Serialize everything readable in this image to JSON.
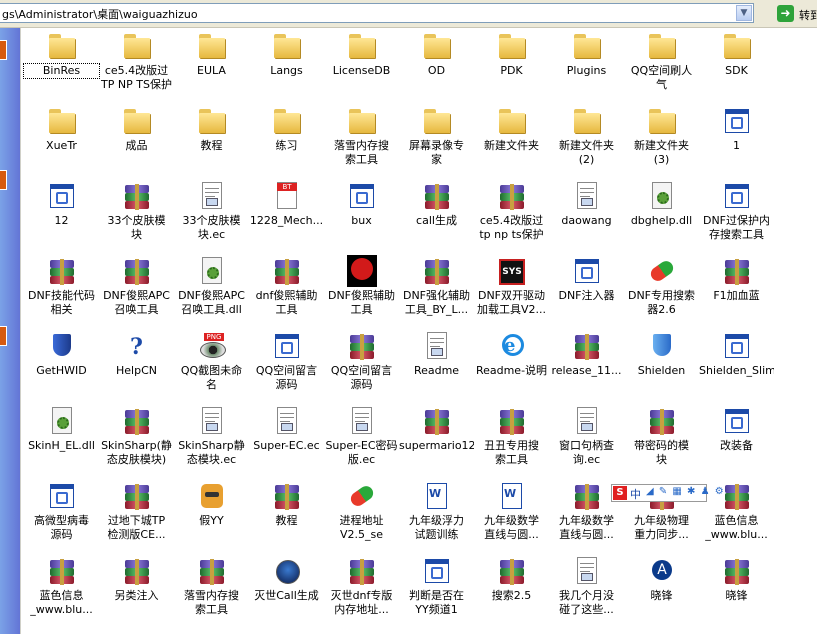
{
  "address_bar": {
    "path": "gs\\Administrator\\桌面\\waiguazhizuo",
    "go_label": "转到"
  },
  "items": [
    {
      "label": "BinRes",
      "kind": "folder"
    },
    {
      "label": "ce5.4改版过\nTP NP TS保护",
      "kind": "folder"
    },
    {
      "label": "EULA",
      "kind": "folder"
    },
    {
      "label": "Langs",
      "kind": "folder"
    },
    {
      "label": "LicenseDB",
      "kind": "folder"
    },
    {
      "label": "OD",
      "kind": "folder"
    },
    {
      "label": "PDK",
      "kind": "folder"
    },
    {
      "label": "Plugins",
      "kind": "folder"
    },
    {
      "label": "QQ空间刷人\n气",
      "kind": "folder"
    },
    {
      "label": "SDK",
      "kind": "folder"
    },
    {
      "label": "XueTr",
      "kind": "folder"
    },
    {
      "label": "成品",
      "kind": "folder"
    },
    {
      "label": "教程",
      "kind": "folder"
    },
    {
      "label": "练习",
      "kind": "folder"
    },
    {
      "label": "落雪内存搜\n索工具",
      "kind": "folder"
    },
    {
      "label": "屏幕录像专\n家",
      "kind": "folder"
    },
    {
      "label": "新建文件夹",
      "kind": "folder"
    },
    {
      "label": "新建文件夹\n(2)",
      "kind": "folder"
    },
    {
      "label": "新建文件夹\n(3)",
      "kind": "folder"
    },
    {
      "label": "1",
      "kind": "exe"
    },
    {
      "label": "12",
      "kind": "exe"
    },
    {
      "label": "33个皮肤模\n块",
      "kind": "rar"
    },
    {
      "label": "33个皮肤模\n块.ec",
      "kind": "doc"
    },
    {
      "label": "1228_Mech...",
      "kind": "bt"
    },
    {
      "label": "bux",
      "kind": "exe"
    },
    {
      "label": "call生成",
      "kind": "rar"
    },
    {
      "label": "ce5.4改版过\ntp np ts保护",
      "kind": "rar"
    },
    {
      "label": "daowang",
      "kind": "doc"
    },
    {
      "label": "dbghelp.dll",
      "kind": "dll"
    },
    {
      "label": "DNF过保护内\n存搜索工具",
      "kind": "exe"
    },
    {
      "label": "DNF技能代码\n相关",
      "kind": "rar"
    },
    {
      "label": "DNF俊熙APC\n召唤工具",
      "kind": "rar"
    },
    {
      "label": "DNF俊熙APC\n召唤工具.dll",
      "kind": "dll"
    },
    {
      "label": "dnf俊熙辅助\n工具",
      "kind": "rar"
    },
    {
      "label": "DNF俊熙辅助\n工具",
      "kind": "rose"
    },
    {
      "label": "DNF强化辅助\n工具_BY_L...",
      "kind": "rar"
    },
    {
      "label": "DNF双开驱动\n加载工具V2...",
      "kind": "sys"
    },
    {
      "label": "DNF注入器",
      "kind": "exe"
    },
    {
      "label": "DNF专用搜索\n器2.6",
      "kind": "pill"
    },
    {
      "label": "F1加血蓝",
      "kind": "rar"
    },
    {
      "label": "GetHWID",
      "kind": "shield"
    },
    {
      "label": "HelpCN",
      "kind": "help"
    },
    {
      "label": "QQ截图未命\n名",
      "kind": "eye"
    },
    {
      "label": "QQ空间留言\n源码",
      "kind": "exe"
    },
    {
      "label": "QQ空间留言\n源码",
      "kind": "rar"
    },
    {
      "label": "Readme",
      "kind": "doc"
    },
    {
      "label": "Readme-说明",
      "kind": "ie"
    },
    {
      "label": "release_11...",
      "kind": "rar"
    },
    {
      "label": "Shielden",
      "kind": "shieldblue"
    },
    {
      "label": "Shielden_Slim",
      "kind": "exe"
    },
    {
      "label": "SkinH_EL.dll",
      "kind": "dll"
    },
    {
      "label": "SkinSharp(静\n态皮肤模块)",
      "kind": "rar"
    },
    {
      "label": "SkinSharp静\n态模块.ec",
      "kind": "doc"
    },
    {
      "label": "Super-EC.ec",
      "kind": "doc"
    },
    {
      "label": "Super-EC密码\n版.ec",
      "kind": "doc"
    },
    {
      "label": "supermario12",
      "kind": "rar"
    },
    {
      "label": "丑丑专用搜\n索工具",
      "kind": "rar"
    },
    {
      "label": "窗口句柄查\n询.ec",
      "kind": "doc"
    },
    {
      "label": "带密码的模\n块",
      "kind": "rar"
    },
    {
      "label": "改装备",
      "kind": "exe"
    },
    {
      "label": "高微型病毒\n源码",
      "kind": "exe"
    },
    {
      "label": "过地下城TP\n检测版CE...",
      "kind": "rar"
    },
    {
      "label": "假YY",
      "kind": "cat"
    },
    {
      "label": "教程",
      "kind": "rar"
    },
    {
      "label": "进程地址\nV2.5_se",
      "kind": "pill"
    },
    {
      "label": "九年级浮力\n试题训练",
      "kind": "word"
    },
    {
      "label": "九年级数学\n直线与圆...",
      "kind": "word"
    },
    {
      "label": "九年级数学\n直线与圆...",
      "kind": "rar"
    },
    {
      "label": "九年级物理\n重力同步...",
      "kind": "rar"
    },
    {
      "label": "蓝色信息\n_www.blu...",
      "kind": "rar"
    },
    {
      "label": "蓝色信息\n_www.blu...",
      "kind": "rar"
    },
    {
      "label": "另类注入",
      "kind": "rar"
    },
    {
      "label": "落雪内存搜\n索工具",
      "kind": "rar"
    },
    {
      "label": "灭世Call生成",
      "kind": "globe"
    },
    {
      "label": "灭世dnf专版\n内存地址...",
      "kind": "rar"
    },
    {
      "label": "判断是否在\nYY频道1",
      "kind": "exe"
    },
    {
      "label": "搜索2.5",
      "kind": "rar"
    },
    {
      "label": "我几个月没\n碰了这些...",
      "kind": "doc"
    },
    {
      "label": "晓锋",
      "kind": "arrow"
    },
    {
      "label": "晓锋",
      "kind": "rar"
    }
  ],
  "ime_toolbar": {
    "s": "S",
    "lang": "中"
  }
}
